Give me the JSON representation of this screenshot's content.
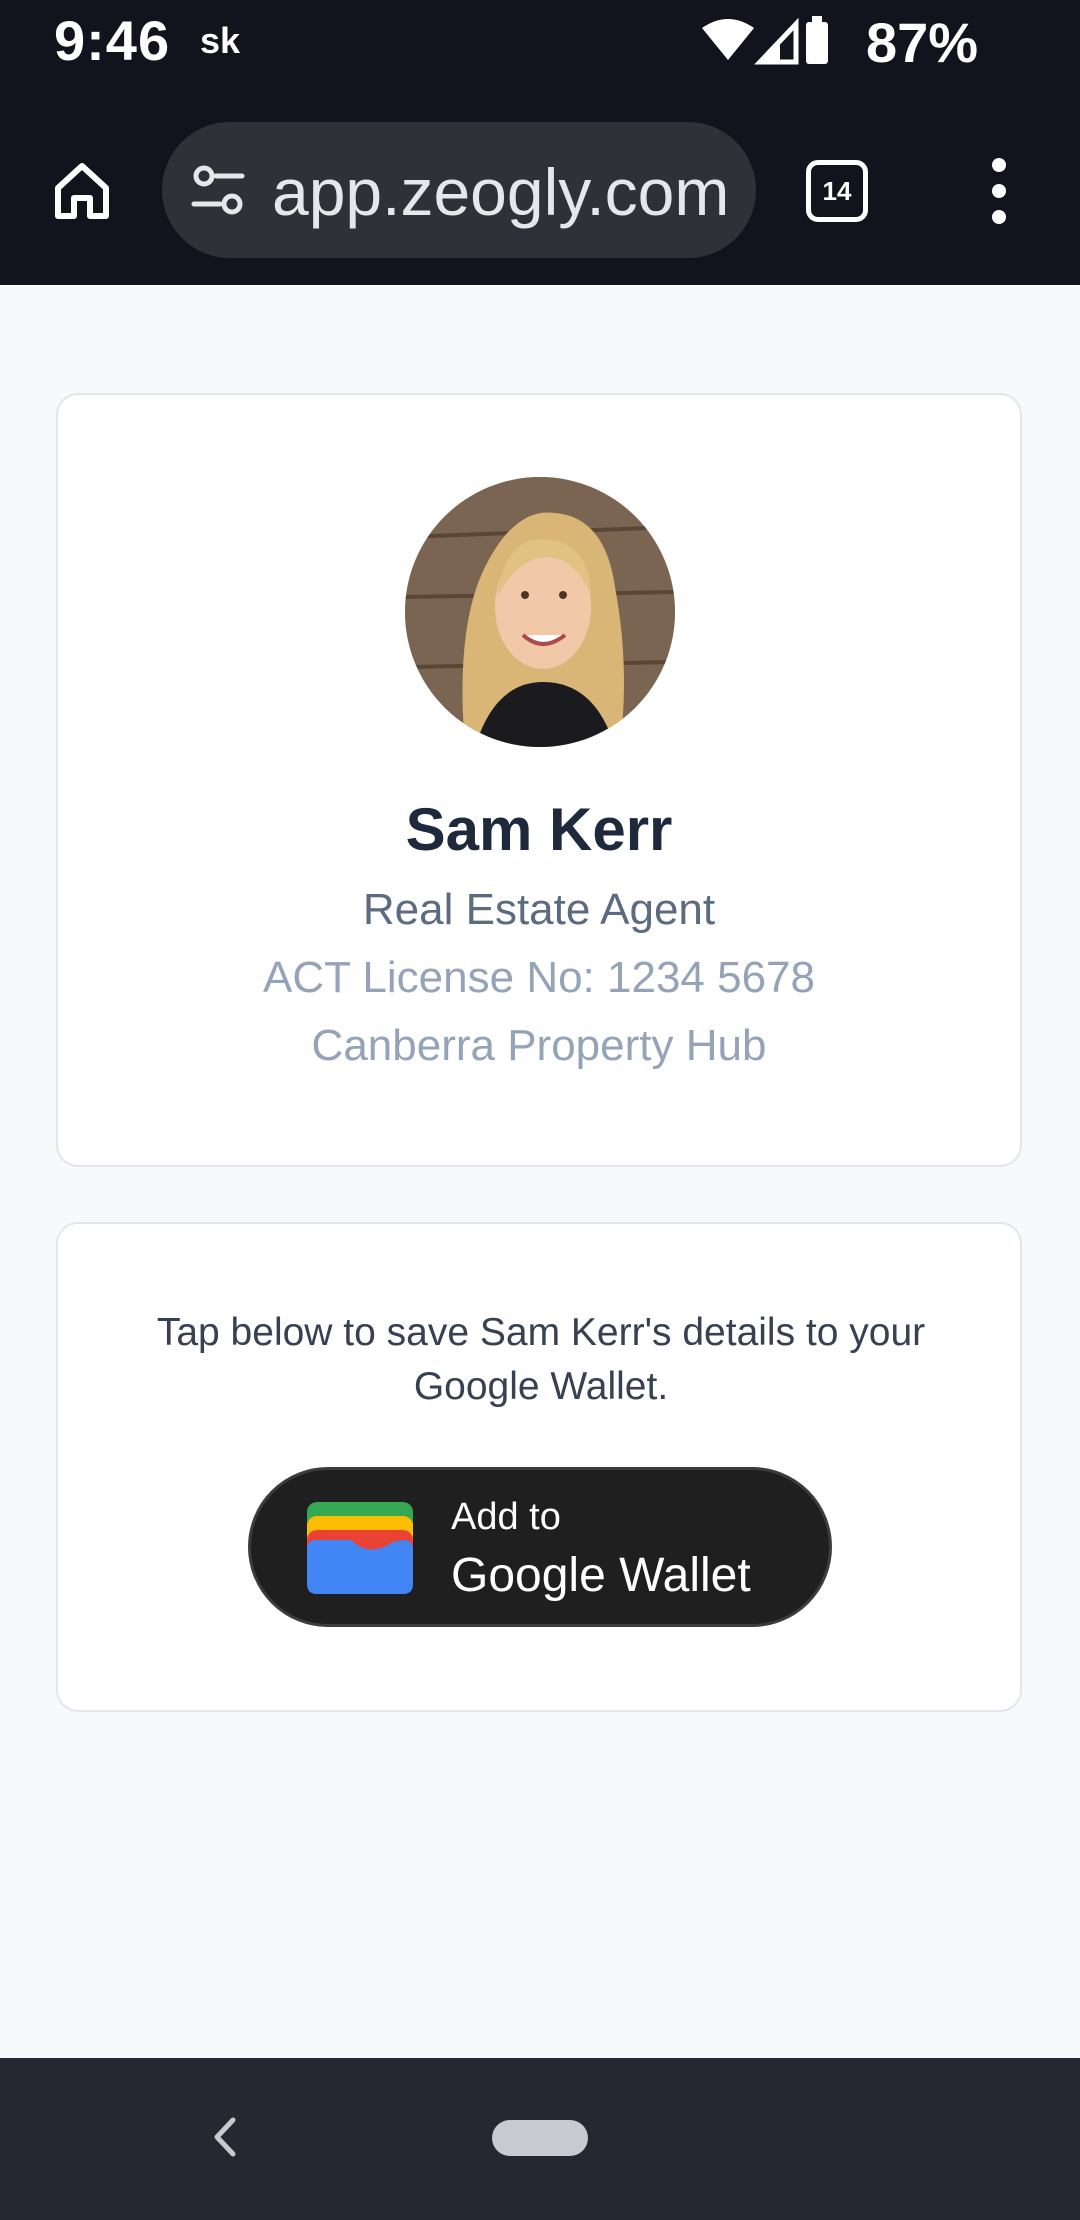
{
  "status_bar": {
    "time": "9:46",
    "carrier": "sk",
    "battery_percent": "87%",
    "icons": [
      "wifi-icon",
      "signal-icon",
      "battery-icon"
    ]
  },
  "browser": {
    "url": "app.zeogly.com",
    "tab_count": "14",
    "icons": [
      "home-icon",
      "site-settings-icon",
      "tabs-icon",
      "more-vert-icon"
    ]
  },
  "profile": {
    "name": "Sam Kerr",
    "role": "Real Estate Agent",
    "license": "ACT License No: 1234 5678",
    "company": "Canberra Property Hub"
  },
  "wallet": {
    "prompt": "Tap below to save Sam Kerr's details to your Google Wallet.",
    "button_line1": "Add to",
    "button_line2": "Google Wallet",
    "icon": "google-wallet-icon"
  },
  "nav": {
    "icons": [
      "back-icon",
      "home-pill"
    ]
  },
  "colors": {
    "browser_bar": "#12131c",
    "page_bg": "#f8f9fb",
    "name_text": "#1e293b",
    "muted_text": "#94a3b8",
    "wallet_button": "#1f1f1f"
  }
}
